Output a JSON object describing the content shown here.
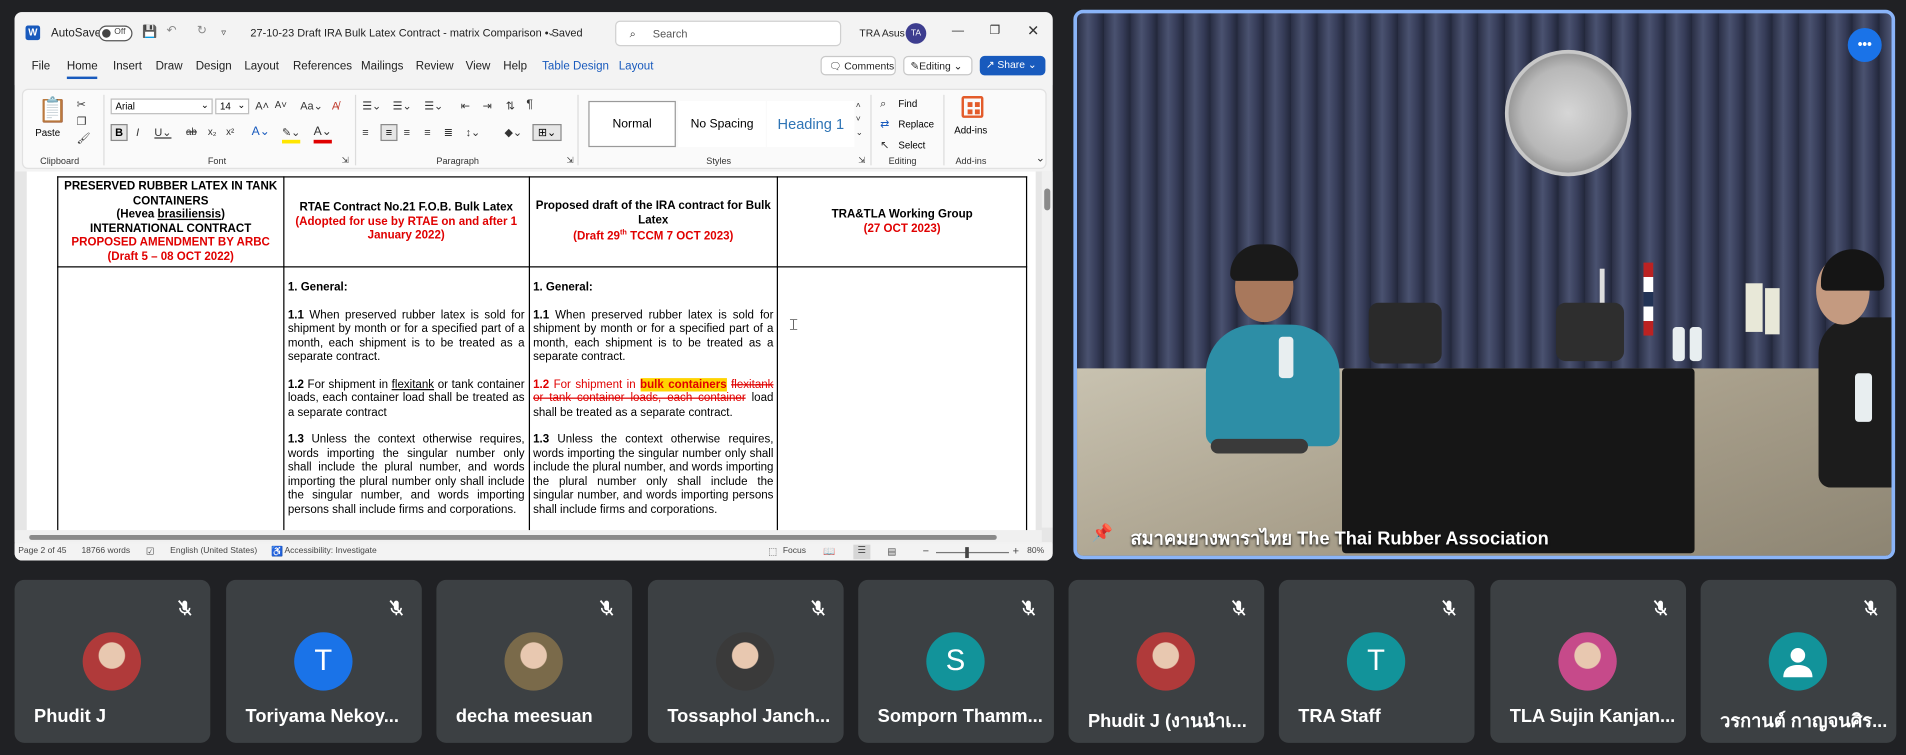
{
  "word": {
    "autosave_label": "AutoSave",
    "autosave_state": "Off",
    "doc_title": "27-10-23 Draft IRA Bulk Latex Contract - matrix Comparison • Saved",
    "search_placeholder": "Search",
    "user_name": "TRA Asus",
    "user_initials": "TA",
    "tabs": [
      "File",
      "Home",
      "Insert",
      "Draw",
      "Design",
      "Layout",
      "References",
      "Mailings",
      "Review",
      "View",
      "Help",
      "Table Design",
      "Layout"
    ],
    "comments_label": "Comments",
    "editing_label": "Editing",
    "share_label": "Share",
    "ribbon": {
      "paste_label": "Paste",
      "font_name": "Arial",
      "font_size": "14",
      "styles": [
        "Normal",
        "No Spacing",
        "Heading 1"
      ],
      "find_label": "Find",
      "replace_label": "Replace",
      "select_label": "Select",
      "addins_label": "Add-ins",
      "groups": [
        "Clipboard",
        "Font",
        "Paragraph",
        "Styles",
        "Editing",
        "Add-ins"
      ]
    },
    "table": {
      "col1_header": [
        "PRESERVED RUBBER LATEX IN TANK CONTAINERS",
        "(Hevea ",
        "brasiliensis",
        ")",
        "INTERNATIONAL CONTRACT",
        "PROPOSED AMENDMENT BY ARBC",
        "(Draft 5 – 08 OCT 2022)"
      ],
      "col2_header": [
        "RTAE Contract No.21 F.O.B. Bulk Latex",
        "(Adopted for use by RTAE on and after 1 January 2022)"
      ],
      "col3_header": [
        "Proposed draft of the IRA contract for Bulk Latex",
        "(Draft 29",
        "th",
        " TCCM 7 OCT 2023)"
      ],
      "col4_header": [
        "TRA&TLA Working Group",
        "(27 OCT 2023)"
      ],
      "col2_body": {
        "general": "1. General:",
        "p11_num": "1.1",
        "p11": " When preserved rubber latex is sold for shipment by month or for a specified part of a month, each shipment is to be treated as a separate contract.",
        "p12_num": "1.2",
        "p12_a": " For shipment in ",
        "p12_b": "flexitank",
        "p12_c": " or tank container loads, each container load shall be treated as a separate contract",
        "p13_num": "1.3",
        "p13": " Unless the context otherwise requires, words importing the singular number only shall include the plural number, and words importing the plural number only shall include the singular number, and words importing persons shall include firms and corporations."
      },
      "col3_body": {
        "general": "1. General:",
        "p11_num": "1.1",
        "p11": " When preserved rubber latex is sold for shipment by month or for a specified part of a month, each shipment is to be treated as a separate contract.",
        "p12_num": "1.2",
        "p12_a": " For shipment in ",
        "p12_hl": "bulk containers",
        "p12_strike": "flexitank or tank container loads, each container",
        "p12_c": " load shall be treated as a separate contract.",
        "p13_num": "1.3",
        "p13": " Unless the context otherwise requires, words importing the singular number only shall include the plural number, and words importing the plural number only shall include the singular number, and words importing persons shall include firms and corporations."
      }
    },
    "status": {
      "page": "Page 2 of 45",
      "words": "18766 words",
      "language": "English (United States)",
      "accessibility": "Accessibility: Investigate",
      "focus": "Focus",
      "zoom": "80%"
    }
  },
  "main_video": {
    "caption": "สมาคมยางพาราไทย The Thai Rubber Association"
  },
  "participants": [
    {
      "name": "Phudit J",
      "avatar_type": "photo",
      "color": "#b03a3a",
      "letter": ""
    },
    {
      "name": "Toriyama Nekoy...",
      "avatar_type": "letter",
      "color": "#1a73e8",
      "letter": "T"
    },
    {
      "name": "decha meesuan",
      "avatar_type": "photo",
      "color": "#7a6a4a",
      "letter": ""
    },
    {
      "name": "Tossaphol Janch...",
      "avatar_type": "photo",
      "color": "#3a3a3a",
      "letter": ""
    },
    {
      "name": "Somporn Thamm...",
      "avatar_type": "letter",
      "color": "#12939a",
      "letter": "S"
    },
    {
      "name": "Phudit J (งานนำเ...",
      "avatar_type": "photo",
      "color": "#b03a3a",
      "letter": ""
    },
    {
      "name": "TRA Staff",
      "avatar_type": "letter",
      "color": "#12939a",
      "letter": "T"
    },
    {
      "name": "TLA Sujin Kanjan...",
      "avatar_type": "photo",
      "color": "#c64a8a",
      "letter": ""
    },
    {
      "name": "วรกานต์ กาญจนศิร...",
      "avatar_type": "person",
      "color": "#12939a",
      "letter": ""
    }
  ]
}
